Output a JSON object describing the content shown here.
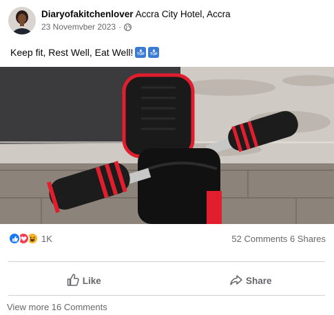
{
  "post": {
    "author": "Diaryofakitchenlover",
    "location": "Accra City Hotel, Accra",
    "date": "23 Novemvber 2023",
    "separator": "·",
    "privacy_icon": "globe-icon",
    "caption": "Keep fit, Rest Well, Eat Well!",
    "caption_emojis": [
      {
        "icon": "top-arrow-emoji",
        "text": "TOP"
      },
      {
        "icon": "top-arrow-emoji",
        "text": "TOP"
      }
    ],
    "image_alt": "Black and red ab roller exercise wheel on a rug and wooden floor"
  },
  "stats": {
    "reaction_icons": [
      "like-reaction-icon",
      "love-reaction-icon",
      "haha-reaction-icon"
    ],
    "reaction_count": "1K",
    "comments_shares": "52 Comments 6 Shares"
  },
  "actions": {
    "like_label": "Like",
    "share_label": "Share"
  },
  "footer": {
    "view_more": "View more 16 Comments"
  },
  "colors": {
    "accent_blue": "#1877f2",
    "love_red": "#f33e58",
    "haha_yellow": "#f7b125",
    "secondary_text": "#65676b"
  }
}
